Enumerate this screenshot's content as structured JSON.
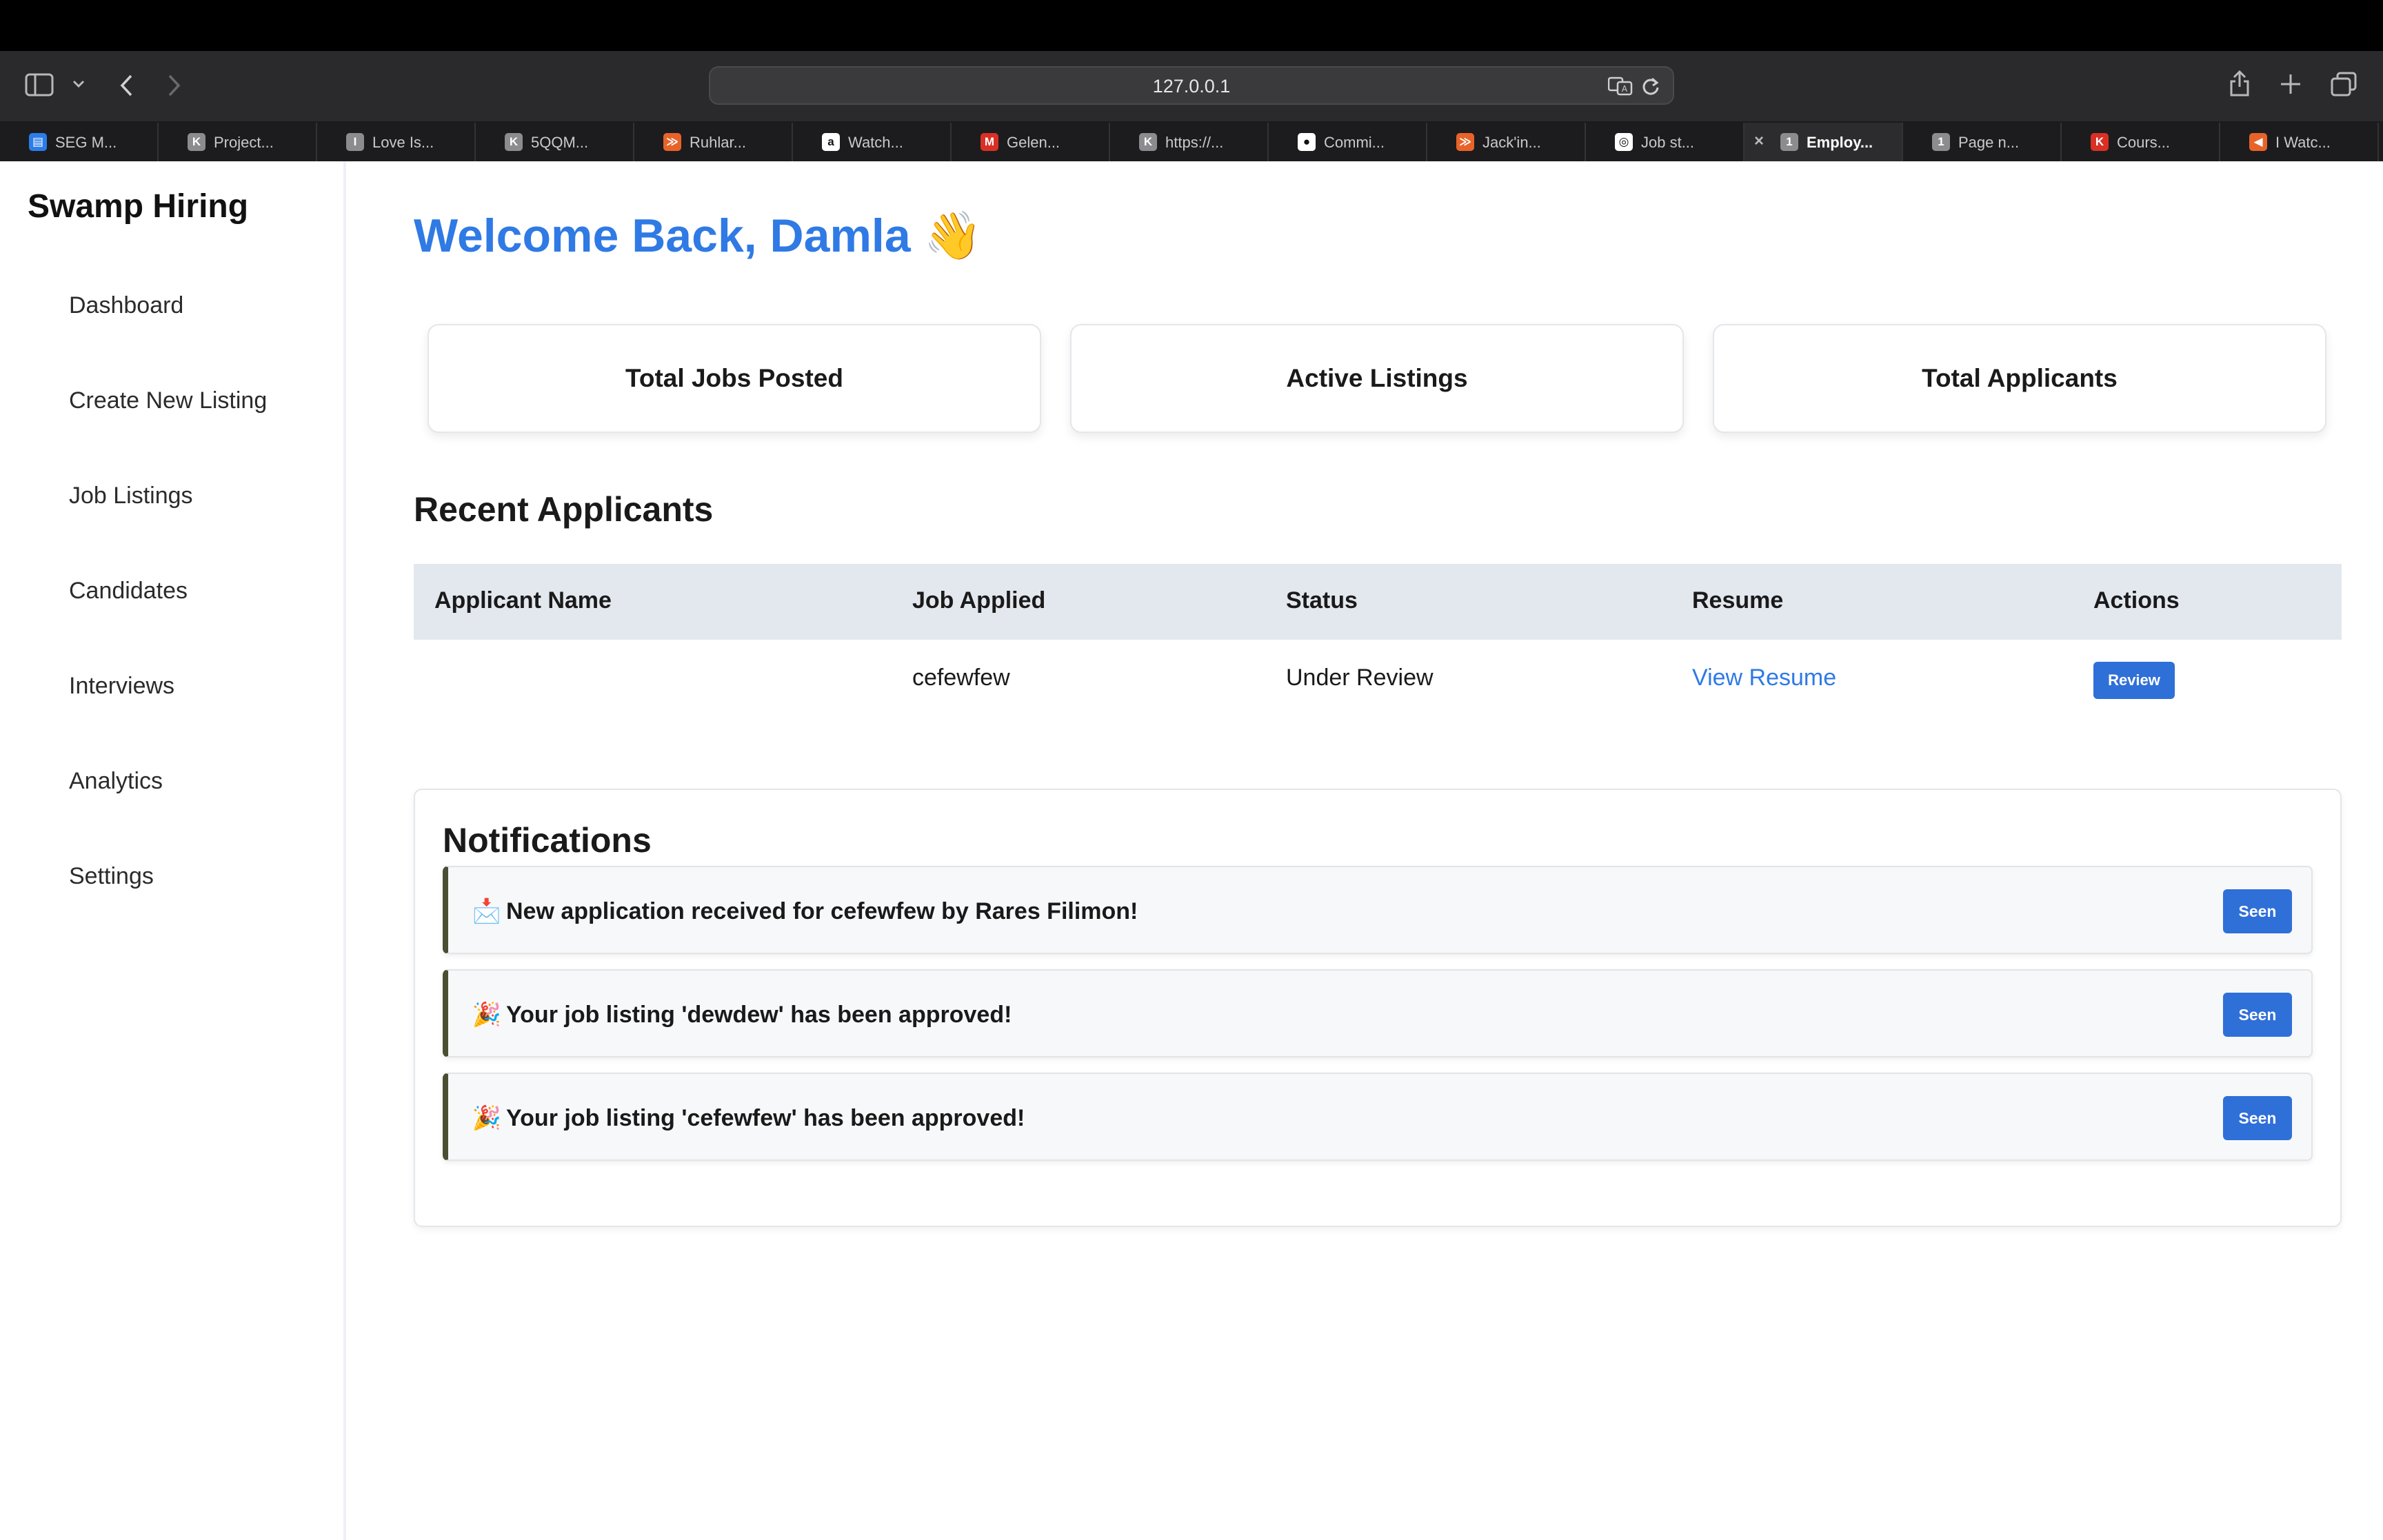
{
  "browser": {
    "url": "127.0.0.1",
    "tabs": [
      {
        "label": "SEG M...",
        "icon": "trello-icon",
        "color": "#2b7de9",
        "glyph": "▤"
      },
      {
        "label": "Project...",
        "icon": "k-icon",
        "color": "#8c8c90",
        "glyph": "K"
      },
      {
        "label": "Love Is...",
        "icon": "i-icon",
        "color": "#8c8c90",
        "glyph": "I"
      },
      {
        "label": "5QQM...",
        "icon": "k-icon",
        "color": "#8c8c90",
        "glyph": "K"
      },
      {
        "label": "Ruhlar...",
        "icon": "tv-icon",
        "color": "#e8632a",
        "glyph": "≫"
      },
      {
        "label": "Watch...",
        "icon": "amazon-icon",
        "color": "#ffffff",
        "glyph": "a"
      },
      {
        "label": "Gelen...",
        "icon": "gmail-icon",
        "color": "#d93025",
        "glyph": "M"
      },
      {
        "label": "https://...",
        "icon": "k-icon",
        "color": "#8c8c90",
        "glyph": "K"
      },
      {
        "label": "Commi...",
        "icon": "github-icon",
        "color": "#ffffff",
        "glyph": "●"
      },
      {
        "label": "Jack'in...",
        "icon": "tv-icon",
        "color": "#e8632a",
        "glyph": "≫"
      },
      {
        "label": "Job st...",
        "icon": "chatgpt-icon",
        "color": "#ffffff",
        "glyph": "◎"
      },
      {
        "label": "Employ...",
        "icon": "one-icon",
        "color": "#8c8c90",
        "glyph": "1",
        "active": true
      },
      {
        "label": "Page n...",
        "icon": "one-icon",
        "color": "#8c8c90",
        "glyph": "1"
      },
      {
        "label": "Cours...",
        "icon": "k-red-icon",
        "color": "#d93025",
        "glyph": "K"
      },
      {
        "label": "I Watc...",
        "icon": "flag-icon",
        "color": "#e8632a",
        "glyph": "◀"
      }
    ]
  },
  "sidebar": {
    "brand": "Swamp Hiring",
    "items": [
      {
        "label": "Dashboard",
        "name": "dashboard"
      },
      {
        "label": "Create New Listing",
        "name": "create-new-listing"
      },
      {
        "label": "Job Listings",
        "name": "job-listings"
      },
      {
        "label": "Candidates",
        "name": "candidates"
      },
      {
        "label": "Interviews",
        "name": "interviews"
      },
      {
        "label": "Analytics",
        "name": "analytics"
      },
      {
        "label": "Settings",
        "name": "settings"
      }
    ]
  },
  "main": {
    "welcome": "Welcome Back, Damla",
    "welcome_emoji": "👋",
    "stats": [
      "Total Jobs Posted",
      "Active Listings",
      "Total Applicants"
    ],
    "recent_title": "Recent Applicants",
    "table": {
      "headers": [
        "Applicant Name",
        "Job Applied",
        "Status",
        "Resume",
        "Actions"
      ],
      "rows": [
        {
          "applicant": "",
          "job": "cefewfew",
          "status": "Under Review",
          "resume": "View Resume",
          "action": "Review"
        }
      ]
    },
    "notifications": {
      "title": "Notifications",
      "items": [
        {
          "emoji": "📩",
          "text": "New application received for cefewfew by Rares Filimon!",
          "button": "Seen"
        },
        {
          "emoji": "🎉",
          "text": "Your job listing 'dewdew' has been approved!",
          "button": "Seen"
        },
        {
          "emoji": "🎉",
          "text": "Your job listing 'cefewfew' has been approved!",
          "button": "Seen"
        }
      ]
    }
  },
  "colors": {
    "accent": "#2f7ae5",
    "button": "#2f6fd8",
    "table_header": "#e3e7ee",
    "notif_border": "#4a4f34"
  }
}
